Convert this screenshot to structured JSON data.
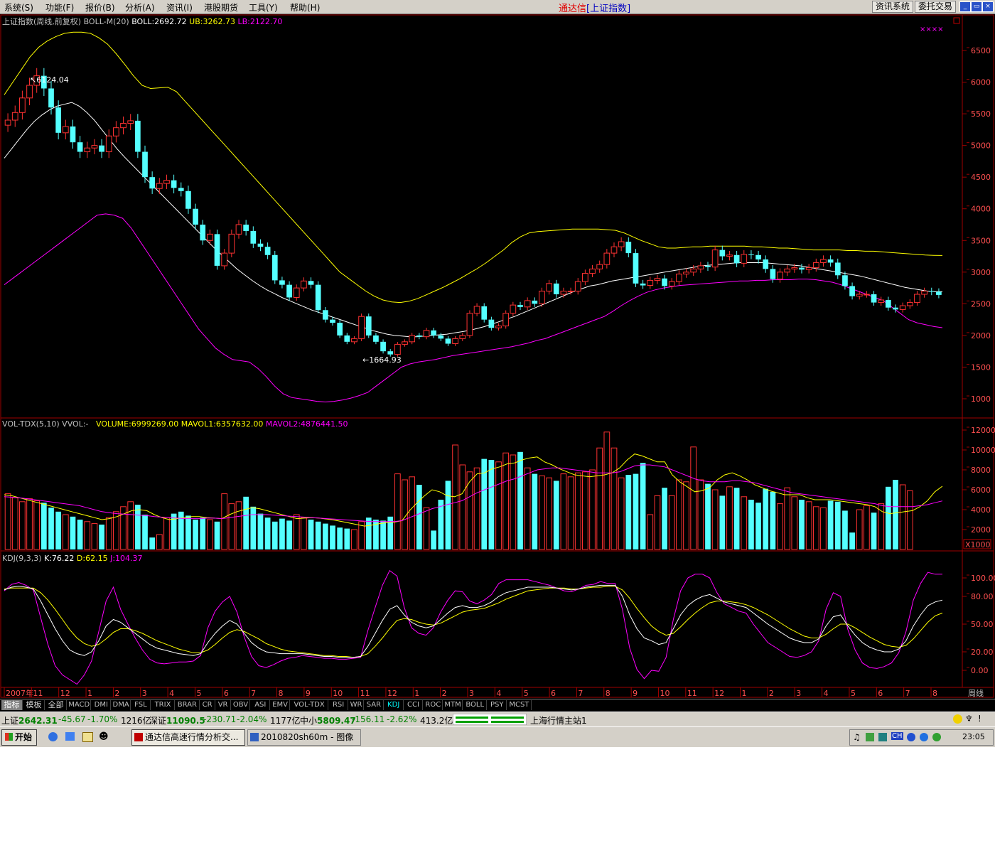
{
  "menu": [
    "系统(S)",
    "功能(F)",
    "报价(B)",
    "分析(A)",
    "资讯(I)",
    "港股期货",
    "工具(Y)",
    "帮助(H)"
  ],
  "title": {
    "app": "通达信",
    "bracket_open": "[",
    "symbol": "上证指数",
    "bracket_close": "]"
  },
  "toolbar": {
    "news": "资讯系统",
    "trade": "委托交易"
  },
  "window_controls": {
    "minimize": "_",
    "restore": "▭",
    "close": "×"
  },
  "main_panel": {
    "title": "上证指数(周线,前复权) BOLL-M(20)",
    "boll": "BOLL:2692.72",
    "ub": "UB:3262.73",
    "lb": "LB:2122.70",
    "marker": "××××",
    "high_label": "6124.04",
    "low_label": "1664.93",
    "yticks": [
      "6500",
      "6000",
      "5500",
      "5000",
      "4500",
      "4000",
      "3500",
      "3000",
      "2500",
      "2000",
      "1500",
      "1000"
    ]
  },
  "volume_panel": {
    "title": "VOL-TDX(5,10) VVOL:-",
    "volume": "VOLUME:6999269.00",
    "mavol1": "MAVOL1:6357632.00",
    "mavol2": "MAVOL2:4876441.50",
    "yticks": [
      "12000",
      "10000",
      "8000",
      "6000",
      "4000",
      "2000"
    ],
    "unit": "X1000"
  },
  "kdj_panel": {
    "title": "KDJ(9,3,3)",
    "k": "K:76.22",
    "d": "D:62.15",
    "j": "J:104.37",
    "yticks": [
      "100.00",
      "80.00",
      "50.00",
      "20.00",
      "0.00"
    ]
  },
  "time_axis": {
    "labels": [
      "2007年",
      "11",
      "12",
      "1",
      "2",
      "3",
      "4",
      "5",
      "6",
      "7",
      "8",
      "9",
      "10",
      "11",
      "12",
      "1",
      "2",
      "3",
      "4",
      "5",
      "6",
      "7",
      "8",
      "9",
      "10",
      "11",
      "12",
      "1",
      "2",
      "3",
      "4",
      "5",
      "6",
      "7",
      "8"
    ],
    "period": "周线"
  },
  "tabs": [
    "指标",
    "模板",
    "全部",
    "MACD",
    "DMI",
    "DMA",
    "FSL",
    "TRIX",
    "BRAR",
    "CR",
    "VR",
    "OBV",
    "ASI",
    "EMV",
    "VOL-TDX",
    "RSI",
    "WR",
    "SAR",
    "KDJ",
    "CCI",
    "ROC",
    "MTM",
    "BOLL",
    "PSY",
    "MCST"
  ],
  "active_tab": "KDJ",
  "status": {
    "sh_name": "上证",
    "sh_value": "2642.31",
    "sh_change": "-45.67",
    "sh_pct": "-1.70%",
    "sh_amount": "1216亿",
    "sz_name": "深证",
    "sz_value": "11090.5",
    "sz_change": "-230.71",
    "sz_pct": "-2.04%",
    "sz_amount": "1177亿",
    "zx_name": "中小",
    "zx_value": "5809.47",
    "zx_change": "-156.11",
    "zx_pct": "-2.62%",
    "zx_amount": "413.2亿",
    "server": "上海行情主站1"
  },
  "taskbar": {
    "start": "开始",
    "task1": "通达信高速行情分析交...",
    "task2": "2010820sh60m - 图像",
    "clock": "23:05"
  },
  "colors": {
    "up": "#ff3232",
    "down": "#54ffff",
    "mid": "#ffffff",
    "upper": "#ffff00",
    "lower": "#ff00ff",
    "axis": "#a00000"
  },
  "chart_data": {
    "type": "candlestick",
    "price_range": [
      1000,
      6500
    ],
    "highest": 6124.04,
    "lowest": 1664.93,
    "closes": [
      5400,
      5520,
      5750,
      5950,
      6100,
      5900,
      5600,
      5200,
      5300,
      5050,
      4900,
      4960,
      5000,
      4900,
      5150,
      5280,
      5350,
      5390,
      4900,
      4500,
      4320,
      4400,
      4450,
      4330,
      4280,
      4000,
      3750,
      3500,
      3600,
      3100,
      3300,
      3600,
      3750,
      3650,
      3450,
      3400,
      3270,
      2870,
      2800,
      2600,
      2750,
      2860,
      2800,
      2400,
      2250,
      2200,
      2000,
      1900,
      1950,
      2300,
      2000,
      1900,
      1750,
      1700,
      1860,
      1900,
      2000,
      1980,
      2080,
      2000,
      1950,
      1870,
      1950,
      2000,
      2350,
      2460,
      2250,
      2120,
      2150,
      2350,
      2480,
      2450,
      2550,
      2500,
      2700,
      2820,
      2650,
      2700,
      2700,
      2850,
      2980,
      3050,
      3120,
      3300,
      3400,
      3480,
      3300,
      2820,
      2790,
      2870,
      2900,
      2780,
      2850,
      2970,
      3000,
      3050,
      3100,
      3080,
      3350,
      3250,
      3270,
      3140,
      3280,
      3270,
      3200,
      3050,
      2890,
      3000,
      3050,
      3070,
      3040,
      3070,
      3150,
      3200,
      3150,
      2950,
      2780,
      2620,
      2650,
      2650,
      2520,
      2560,
      2440,
      2410,
      2470,
      2520,
      2650,
      2700,
      2690,
      2640
    ],
    "mid": [
      4800,
      4950,
      5100,
      5250,
      5380,
      5480,
      5560,
      5620,
      5650,
      5680,
      5620,
      5520,
      5400,
      5250,
      5100,
      4950,
      4820,
      4700,
      4580,
      4460,
      4340,
      4220,
      4100,
      3980,
      3860,
      3740,
      3620,
      3500,
      3380,
      3270,
      3160,
      3050,
      2960,
      2870,
      2790,
      2720,
      2660,
      2600,
      2550,
      2500,
      2450,
      2400,
      2360,
      2320,
      2280,
      2240,
      2200,
      2160,
      2120,
      2080,
      2050,
      2020,
      2000,
      1990,
      1980,
      1980,
      1990,
      2000,
      2010,
      2020,
      2040,
      2060,
      2080,
      2110,
      2140,
      2180,
      2220,
      2260,
      2300,
      2350,
      2400,
      2450,
      2500,
      2550,
      2600,
      2650,
      2700,
      2740,
      2780,
      2800,
      2830,
      2860,
      2880,
      2900,
      2920,
      2940,
      2960,
      2980,
      3000,
      3020,
      3040,
      3060,
      3080,
      3100,
      3110,
      3120,
      3130,
      3140,
      3150,
      3150,
      3150,
      3150,
      3140,
      3130,
      3120,
      3110,
      3100,
      3080,
      3060,
      3040,
      3020,
      3000,
      2980,
      2960,
      2940,
      2910,
      2880,
      2850,
      2820,
      2790,
      2760,
      2740,
      2720,
      2700,
      2690,
      2692
    ],
    "upper": [
      5800,
      6000,
      6200,
      6400,
      6550,
      6650,
      6720,
      6770,
      6790,
      6790,
      6770,
      6700,
      6600,
      6450,
      6280,
      6100,
      5950,
      5900,
      5910,
      5920,
      5850,
      5700,
      5550,
      5400,
      5250,
      5100,
      4950,
      4800,
      4650,
      4500,
      4350,
      4200,
      4050,
      3900,
      3750,
      3600,
      3450,
      3300,
      3150,
      3000,
      2900,
      2800,
      2700,
      2620,
      2560,
      2530,
      2520,
      2540,
      2580,
      2640,
      2700,
      2760,
      2830,
      2900,
      2980,
      3060,
      3150,
      3250,
      3350,
      3470,
      3560,
      3620,
      3640,
      3650,
      3660,
      3670,
      3680,
      3680,
      3680,
      3680,
      3670,
      3660,
      3620,
      3560,
      3500,
      3450,
      3400,
      3380,
      3380,
      3390,
      3400,
      3400,
      3410,
      3410,
      3410,
      3410,
      3410,
      3400,
      3400,
      3390,
      3380,
      3380,
      3370,
      3360,
      3350,
      3350,
      3350,
      3350,
      3340,
      3340,
      3330,
      3330,
      3320,
      3310,
      3300,
      3290,
      3280,
      3270,
      3265,
      3263
    ],
    "lower": [
      2800,
      2900,
      3000,
      3100,
      3200,
      3300,
      3400,
      3500,
      3600,
      3700,
      3800,
      3900,
      3920,
      3900,
      3850,
      3700,
      3500,
      3300,
      3100,
      2900,
      2700,
      2500,
      2300,
      2100,
      1950,
      1800,
      1700,
      1620,
      1600,
      1580,
      1480,
      1350,
      1200,
      1080,
      1020,
      1000,
      980,
      960,
      950,
      960,
      980,
      1010,
      1050,
      1100,
      1200,
      1300,
      1400,
      1500,
      1550,
      1580,
      1600,
      1620,
      1650,
      1680,
      1700,
      1720,
      1740,
      1760,
      1780,
      1800,
      1820,
      1850,
      1880,
      1920,
      1950,
      2000,
      2050,
      2100,
      2150,
      2200,
      2250,
      2300,
      2380,
      2470,
      2550,
      2620,
      2680,
      2720,
      2750,
      2770,
      2790,
      2800,
      2810,
      2820,
      2830,
      2840,
      2850,
      2860,
      2860,
      2870,
      2870,
      2880,
      2880,
      2880,
      2890,
      2890,
      2880,
      2860,
      2840,
      2800,
      2750,
      2700,
      2650,
      2600,
      2550,
      2450,
      2350,
      2250,
      2200,
      2170,
      2140,
      2123
    ],
    "volume": [
      5600,
      5200,
      4800,
      5100,
      4900,
      4700,
      4200,
      3800,
      3500,
      3300,
      3000,
      2800,
      2600,
      2500,
      3200,
      3800,
      4300,
      4800,
      4500,
      3500,
      1200,
      1500,
      3200,
      3600,
      3800,
      3400,
      3000,
      3200,
      3000,
      2800,
      5600,
      4600,
      4800,
      5300,
      4300,
      3600,
      3200,
      2800,
      3100,
      2900,
      3500,
      3200,
      3000,
      2800,
      2600,
      2400,
      2200,
      2100,
      2000,
      2800,
      3200,
      3000,
      2900,
      3300,
      7600,
      7000,
      7300,
      6500,
      4200,
      1900,
      5000,
      6900,
      10500,
      8500,
      7800,
      8200,
      9100,
      9000,
      8800,
      9700,
      9500,
      9800,
      8200,
      7600,
      7400,
      7200,
      6900,
      7600,
      7300,
      7700,
      7800,
      8000,
      10200,
      11800,
      10200,
      7200,
      7500,
      7600,
      8700,
      3500,
      5400,
      6200,
      5400,
      7000,
      6800,
      10300,
      7000,
      6600,
      6000,
      5400,
      6300,
      6200,
      5300,
      5000,
      4700,
      6100,
      5800,
      4600,
      6200,
      5300,
      5000,
      4800,
      4300,
      4200,
      4900,
      4800,
      3900,
      1700,
      4000,
      4400,
      3700,
      4600,
      6300,
      7000,
      6500,
      5900
    ],
    "mavol1": [
      5500,
      5400,
      5200,
      5000,
      4800,
      4600,
      4400,
      4200,
      4000,
      3800,
      3600,
      3400,
      3200,
      3000,
      3100,
      3300,
      3600,
      3900,
      4000,
      3900,
      3500,
      3200,
      3000,
      3100,
      3200,
      3300,
      3300,
      3200,
      3150,
      3100,
      3500,
      3800,
      4000,
      4200,
      4100,
      3900,
      3700,
      3500,
      3300,
      3100,
      3150,
      3200,
      3150,
      3050,
      2950,
      2800,
      2650,
      2500,
      2350,
      2450,
      2600,
      2700,
      2750,
      2900,
      3900,
      4700,
      5400,
      6000,
      5800,
      5400,
      5300,
      5600,
      6800,
      7600,
      7700,
      8100,
      8300,
      8600,
      8700,
      9000,
      9200,
      9300,
      8800,
      8500,
      8100,
      7800,
      7500,
      7400,
      7300,
      7400,
      7500,
      7700,
      8200,
      9000,
      9600,
      9400,
      9100,
      8800,
      8800,
      7500,
      6800,
      6300,
      5800,
      5900,
      6200,
      7000,
      7500,
      7700,
      7400,
      7000,
      6500,
      6200,
      5900,
      5700,
      5500,
      5500,
      5500,
      5200,
      5000,
      5000,
      5000,
      4900,
      4800,
      4700,
      4600,
      4500,
      4300,
      3800,
      3600,
      3700,
      3800,
      3900,
      4300,
      4900,
      5800,
      6357
    ],
    "mavol2": [
      5300,
      5250,
      5200,
      5100,
      5000,
      4900,
      4800,
      4700,
      4600,
      4500,
      4400,
      4200,
      4000,
      3800,
      3700,
      3600,
      3550,
      3500,
      3450,
      3400,
      3300,
      3250,
      3200,
      3150,
      3100,
      3100,
      3100,
      3150,
      3150,
      3100,
      3200,
      3300,
      3400,
      3500,
      3500,
      3500,
      3450,
      3400,
      3350,
      3300,
      3250,
      3200,
      3150,
      3100,
      3050,
      3000,
      2950,
      2900,
      2850,
      2800,
      2800,
      2800,
      2800,
      2900,
      3200,
      3500,
      3800,
      4100,
      4300,
      4500,
      4700,
      4900,
      5300,
      5700,
      6000,
      6300,
      6600,
      6900,
      7100,
      7400,
      7700,
      8000,
      8100,
      8200,
      8200,
      8100,
      8000,
      7900,
      7800,
      7700,
      7700,
      7700,
      7800,
      8100,
      8400,
      8500,
      8500,
      8400,
      8300,
      8000,
      7700,
      7400,
      7100,
      6900,
      6800,
      6800,
      6800,
      6900,
      6900,
      6800,
      6700,
      6500,
      6300,
      6100,
      5900,
      5700,
      5600,
      5500,
      5400,
      5300,
      5200,
      5100,
      5000,
      4900,
      4800,
      4700,
      4600,
      4400,
      4300,
      4300,
      4300,
      4300,
      4400,
      4500,
      4700,
      4876
    ],
    "k": [
      87,
      90,
      91,
      90,
      88,
      75,
      60,
      45,
      32,
      22,
      18,
      16,
      20,
      32,
      48,
      55,
      52,
      46,
      40,
      34,
      28,
      24,
      22,
      20,
      18,
      17,
      16,
      18,
      30,
      40,
      48,
      54,
      50,
      40,
      30,
      24,
      20,
      19,
      18,
      18,
      18,
      18,
      17,
      16,
      15,
      15,
      14,
      14,
      14,
      15,
      26,
      40,
      54,
      66,
      70,
      60,
      52,
      48,
      46,
      48,
      55,
      62,
      68,
      70,
      68,
      68,
      70,
      74,
      80,
      84,
      86,
      88,
      90,
      90,
      90,
      90,
      89,
      88,
      87,
      88,
      90,
      91,
      92,
      92,
      92,
      80,
      60,
      45,
      35,
      32,
      28,
      30,
      45,
      60,
      70,
      76,
      80,
      82,
      78,
      74,
      72,
      70,
      68,
      62,
      56,
      50,
      45,
      40,
      35,
      32,
      30,
      30,
      34,
      48,
      58,
      60,
      48,
      38,
      30,
      25,
      22,
      20,
      20,
      23,
      32,
      48,
      60,
      70,
      74,
      76
    ],
    "d": [
      88,
      89,
      89,
      89,
      89,
      84,
      76,
      66,
      55,
      44,
      35,
      29,
      26,
      28,
      34,
      41,
      45,
      45,
      43,
      40,
      36,
      32,
      29,
      26,
      23,
      21,
      19,
      19,
      22,
      28,
      35,
      41,
      44,
      42,
      38,
      34,
      29,
      26,
      23,
      21,
      20,
      19,
      18,
      17,
      16,
      16,
      15,
      15,
      14,
      15,
      18,
      26,
      35,
      45,
      54,
      56,
      55,
      52,
      50,
      49,
      51,
      55,
      59,
      63,
      65,
      66,
      67,
      70,
      73,
      77,
      80,
      83,
      86,
      87,
      88,
      89,
      89,
      89,
      88,
      88,
      89,
      90,
      90,
      91,
      91,
      87,
      78,
      67,
      57,
      48,
      42,
      38,
      40,
      47,
      55,
      62,
      68,
      73,
      75,
      75,
      74,
      73,
      71,
      68,
      64,
      60,
      55,
      50,
      45,
      41,
      37,
      35,
      35,
      39,
      45,
      50,
      50,
      46,
      41,
      36,
      32,
      28,
      26,
      25,
      27,
      34,
      43,
      52,
      59,
      62
    ],
    "j": [
      86,
      93,
      95,
      92,
      87,
      57,
      28,
      5,
      -5,
      -10,
      -15,
      -5,
      10,
      42,
      75,
      90,
      66,
      50,
      35,
      22,
      12,
      8,
      7,
      8,
      9,
      9,
      10,
      16,
      46,
      64,
      74,
      80,
      63,
      36,
      15,
      5,
      3,
      6,
      10,
      13,
      14,
      16,
      15,
      14,
      13,
      13,
      12,
      12,
      13,
      14,
      43,
      68,
      92,
      108,
      102,
      68,
      46,
      40,
      38,
      46,
      63,
      76,
      86,
      85,
      75,
      72,
      76,
      82,
      94,
      98,
      98,
      98,
      98,
      96,
      94,
      92,
      89,
      86,
      85,
      88,
      92,
      93,
      96,
      94,
      94,
      66,
      24,
      1,
      -9,
      0,
      -1,
      14,
      55,
      86,
      100,
      104,
      104,
      100,
      84,
      72,
      68,
      64,
      62,
      50,
      40,
      30,
      25,
      20,
      15,
      14,
      16,
      20,
      32,
      66,
      84,
      80,
      44,
      22,
      8,
      3,
      2,
      4,
      8,
      19,
      42,
      76,
      94,
      106,
      104,
      104
    ]
  }
}
